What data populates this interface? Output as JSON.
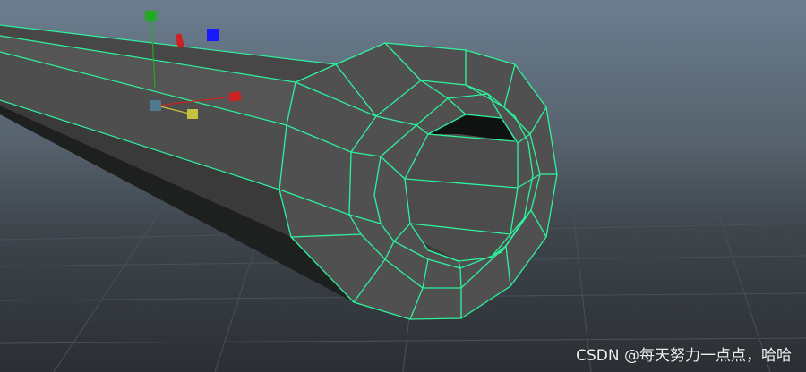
{
  "viewport": {
    "background_top": "#6b7d8f",
    "background_bottom": "#2b2f34",
    "grid_color": "#4a5058",
    "mesh_face_color": "#505050",
    "mesh_dark_color": "#1e1f1f",
    "wireframe_color": "#2ef29c"
  },
  "manipulator": {
    "x_axis_color": "#cc2222",
    "y_axis_color": "#22aa22",
    "z_axis_color": "#1a1aff",
    "plane_color": "#c8c040",
    "center_color": "#4f7a8f"
  },
  "watermark": "CSDN @每天努力一点点，哈哈"
}
